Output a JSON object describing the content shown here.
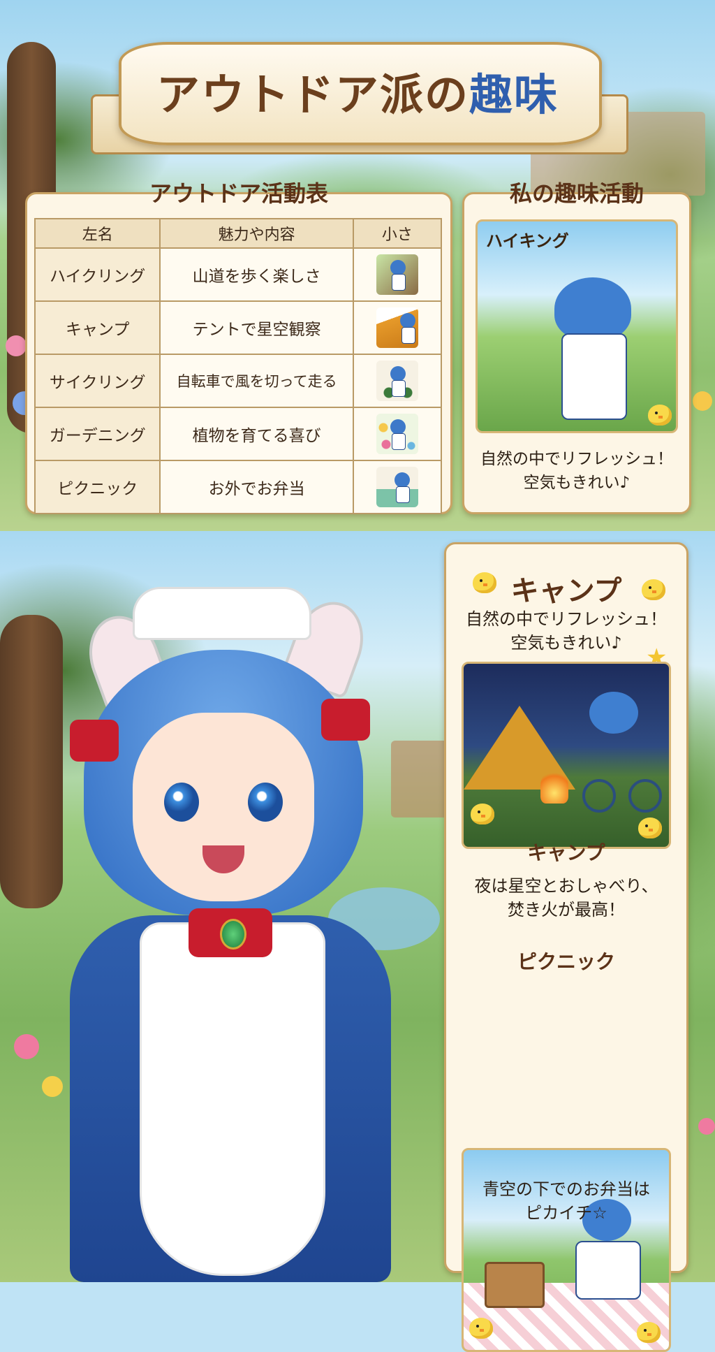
{
  "title": {
    "main": "アウトドア派の",
    "accent": "趣味"
  },
  "activity_table": {
    "title": "アウトドア活動表",
    "headers": [
      "左名",
      "魅力や内容",
      "小さ"
    ],
    "rows": [
      {
        "name": "ハイクリング",
        "desc": "山道を歩く楽しさ",
        "icon": "hiking-icon"
      },
      {
        "name": "キャンプ",
        "desc": "テントで星空観察",
        "icon": "tent-icon"
      },
      {
        "name": "サイクリング",
        "desc": "自転車で風を切って走る",
        "icon": "bicycle-icon"
      },
      {
        "name": "ガーデニング",
        "desc": "植物を育てる喜び",
        "icon": "flower-icon"
      },
      {
        "name": "ピクニック",
        "desc": "お外でお弁当",
        "icon": "picnic-icon"
      }
    ]
  },
  "hobby_panel": {
    "title": "私の趣味活動",
    "scene_label": "ハイキング",
    "caption_lines": [
      "自然の中でリフレッシュ！",
      "空気もきれい♪"
    ]
  },
  "camp_panel": {
    "heading": "キャンプ",
    "intro_lines": [
      "自然の中でリフレッシュ！",
      "空気もきれい♪"
    ],
    "scene_label": "キャンプ",
    "caption_lines": [
      "夜は星空とおしゃべり、",
      "焚き火が最高！"
    ]
  },
  "picnic_panel": {
    "scene_label": "ピクニック",
    "caption_lines": [
      "青空の下でのお弁当は",
      "ピカイチ☆"
    ]
  },
  "colors": {
    "accent": "#2f5fae",
    "title_brown": "#6b3f1d",
    "frame": "#c9a364"
  }
}
